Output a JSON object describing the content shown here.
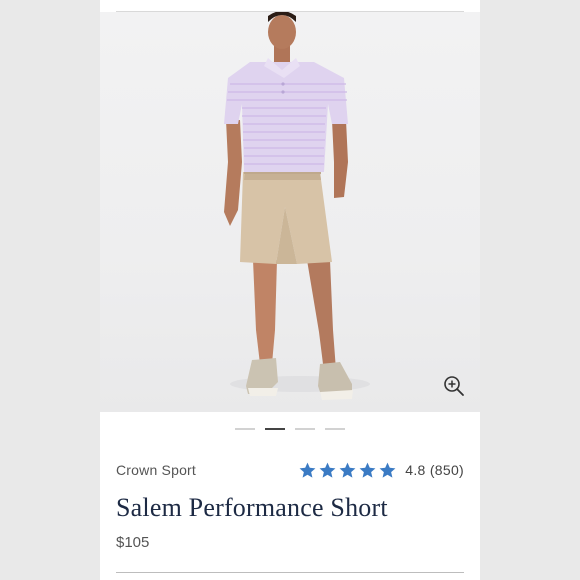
{
  "product": {
    "brand": "Crown Sport",
    "title": "Salem Performance Short",
    "price": "$105",
    "rating": {
      "value": 4.8,
      "text": "4.8 (850)",
      "stars_filled": 5,
      "star_color": "#3b7bc4"
    },
    "image_alt": "Model wearing lavender striped polo and khaki shorts with tan sneakers"
  },
  "gallery": {
    "count": 4,
    "active_index": 1
  },
  "icons": {
    "zoom": "zoom-in-icon",
    "star": "star-icon"
  },
  "colors": {
    "title": "#1d2a44",
    "star": "#3b7bc4",
    "background": "#ffffff"
  }
}
